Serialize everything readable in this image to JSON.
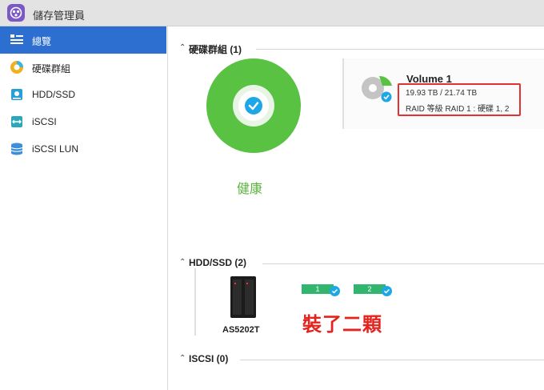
{
  "app": {
    "title": "儲存管理員"
  },
  "sidebar": {
    "items": [
      {
        "label": "總覽",
        "icon": "overview-icon",
        "active": true
      },
      {
        "label": "硬碟群組",
        "icon": "disk-group-icon",
        "active": false
      },
      {
        "label": "HDD/SSD",
        "icon": "hdd-icon",
        "active": false
      },
      {
        "label": "iSCSI",
        "icon": "iscsi-icon",
        "active": false
      },
      {
        "label": "iSCSI LUN",
        "icon": "iscsi-lun-icon",
        "active": false
      }
    ]
  },
  "main": {
    "disk_group_section": {
      "title": "硬碟群組 (1)",
      "health_status": "健康"
    },
    "volume": {
      "name": "Volume 1",
      "capacity": "19.93 TB / 21.74 TB",
      "raid_info": "RAID 等級 RAID 1 : 硬碟 1, 2"
    },
    "hdd_section": {
      "title": "HDD/SSD (2)",
      "device_model": "AS5202T",
      "bays": [
        "1",
        "2"
      ],
      "annotation": "裝了二顆"
    },
    "iscsi_section": {
      "title": "ISCSI (0)"
    }
  },
  "colors": {
    "accent": "#2c6fd0",
    "healthy": "#5ac243",
    "check": "#1ea7e6",
    "highlight": "#e33232",
    "bay": "#31b56f"
  }
}
